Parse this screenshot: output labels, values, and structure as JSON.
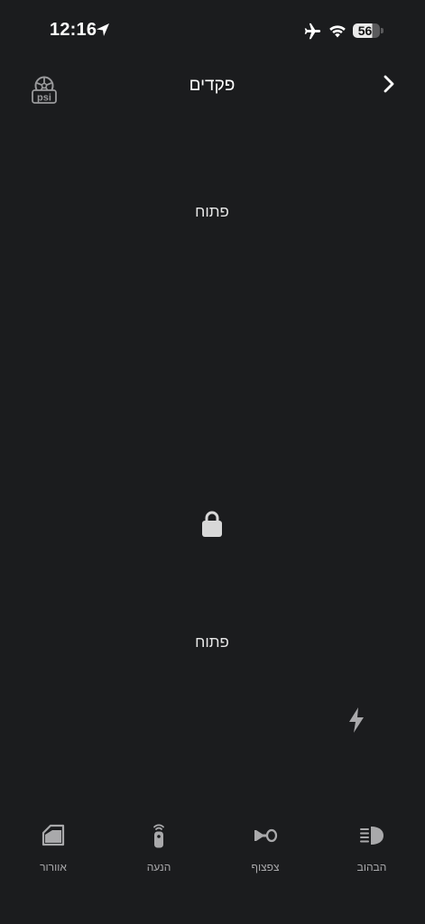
{
  "status_bar": {
    "time": "12:16",
    "battery": "56",
    "battery_level": 0.56
  },
  "header": {
    "title": "פקדים"
  },
  "controls": {
    "status_top": "פתוח",
    "status_bottom": "פתוח"
  },
  "toolbar": {
    "items": [
      {
        "label": "אוורור",
        "icon": "window-vent-icon"
      },
      {
        "label": "הנעה",
        "icon": "remote-start-icon"
      },
      {
        "label": "צפצוף",
        "icon": "horn-icon"
      },
      {
        "label": "הבהוב",
        "icon": "headlights-icon"
      }
    ]
  },
  "colors": {
    "background": "#1b1c1e",
    "text_primary": "#ffffff",
    "icon_muted": "#a9a9ab"
  }
}
